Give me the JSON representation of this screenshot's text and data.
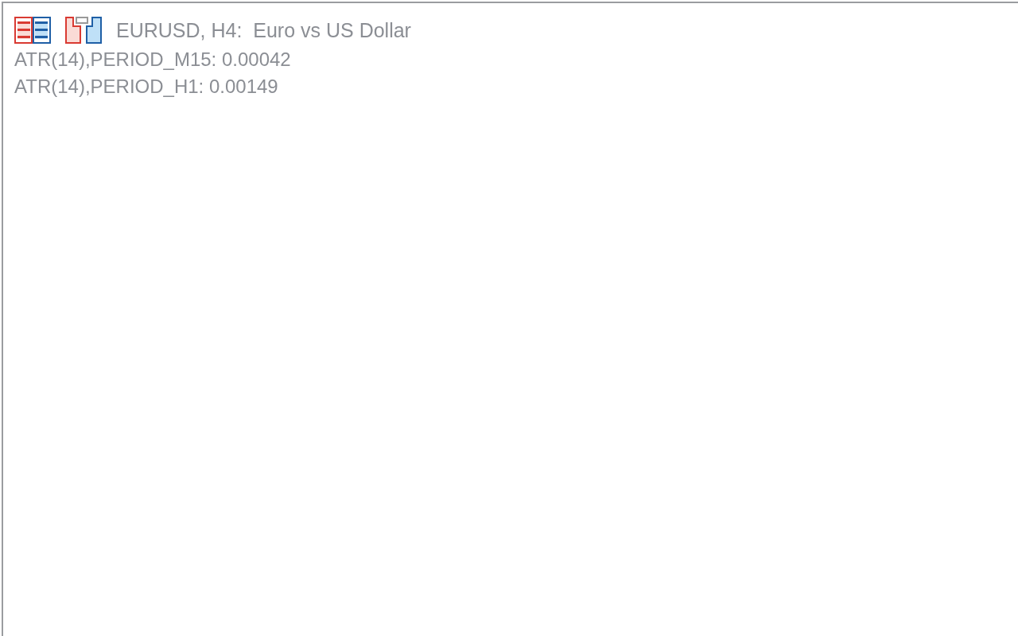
{
  "chart": {
    "title": "EURUSD, H4:  Euro vs US Dollar",
    "indicators": [
      {
        "text": "ATR(14),PERIOD_M15: 0.00042"
      },
      {
        "text": "ATR(14),PERIOD_H1: 0.00149"
      }
    ]
  }
}
